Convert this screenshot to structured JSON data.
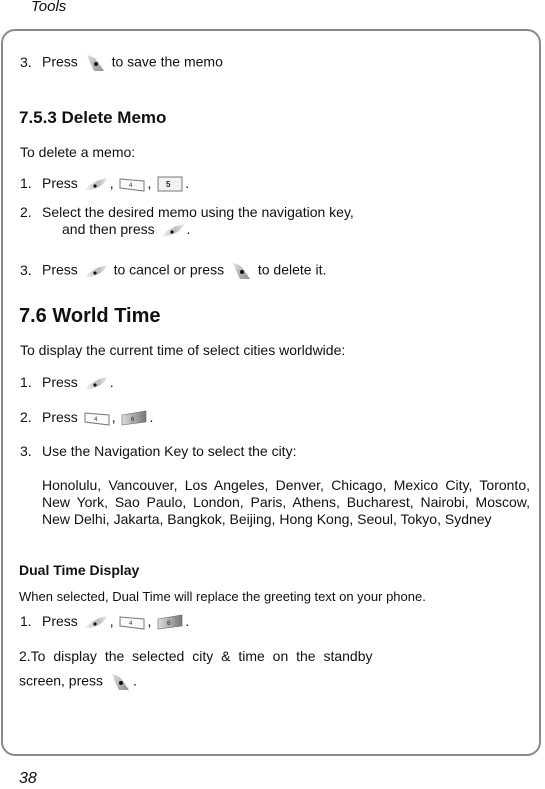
{
  "header": {
    "section": "Tools"
  },
  "page_number": "38",
  "lines": {
    "save_step_num": "3.",
    "save_step_pre": "Press",
    "save_step_post": "to save the memo",
    "delete_title": "7.5.3 Delete Memo",
    "delete_intro": "To delete a memo:",
    "del1_num": "1.",
    "del1_pre": "Press",
    "del1_sep1": ",",
    "del1_sep2": ",",
    "del1_end": ".",
    "del2_num": "2.",
    "del2_text": "Select the desired memo using the navigation key,",
    "del2_cont": "and then press",
    "del2_end": ".",
    "del3_num": "3.",
    "del3_pre": "Press",
    "del3_mid": "to cancel or press",
    "del3_post": "to delete it.",
    "world_title": "7.6 World Time",
    "world_intro": "To display the current time of select cities worldwide:",
    "w1_num": "1.",
    "w1_pre": "Press",
    "w1_end": ".",
    "w2_num": "2.",
    "w2_pre": "Press",
    "w2_sep": ",",
    "w2_end": ".",
    "w3_num": "3.",
    "w3_text": "Use the Navigation Key to select the city:",
    "cities": "Honolulu, Vancouver, Los Angeles, Denver, Chicago, Mexico City, Toronto, New York, Sao Paulo, London, Paris, Athens, Bucharest, Nairobi, Moscow, New Delhi, Jakarta, Bangkok, Beijing, Hong Kong, Seoul, Tokyo, Sydney",
    "dual_title": "Dual Time Display",
    "dual_intro": "When selected, Dual Time will replace the greeting text on your phone.",
    "d1_num": "1.",
    "d1_pre": "Press",
    "d1_sep1": ",",
    "d1_sep2": ",",
    "d1_end": ".",
    "d2_text": "2.To display the selected city & time on the standby",
    "d2_cont": "screen, press",
    "d2_end": "."
  },
  "keys": {
    "ok": "ok-key",
    "soft": "right-soft-key",
    "num4": "4",
    "num5": "5",
    "num6": "6"
  },
  "colors": {
    "frame": "#8a8a8a",
    "text": "#111111"
  }
}
